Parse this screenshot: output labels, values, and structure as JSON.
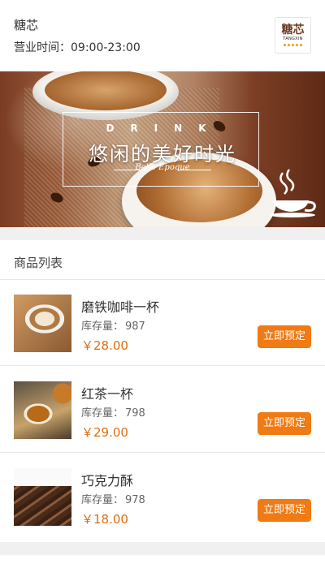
{
  "shop": {
    "name": "糖芯",
    "hours_label": "营业时间：",
    "hours": "09:00-23:00",
    "logo_cn": "糖芯",
    "logo_en": "TANGXIN"
  },
  "banner": {
    "drink": "DRINK",
    "slogan": "悠闲的美好时光",
    "subtitle": "Belle Epoque"
  },
  "products": {
    "title": "商品列表",
    "stock_label": "库存量：",
    "reserve_label": "立即预定",
    "items": [
      {
        "name": "磨铁咖啡一杯",
        "stock": "987",
        "price": "￥28.00"
      },
      {
        "name": "红茶一杯",
        "stock": "798",
        "price": "￥29.00"
      },
      {
        "name": "巧克力酥",
        "stock": "978",
        "price": "￥18.00"
      }
    ]
  },
  "colors": {
    "accent": "#f07a13",
    "price": "#e06d10"
  }
}
